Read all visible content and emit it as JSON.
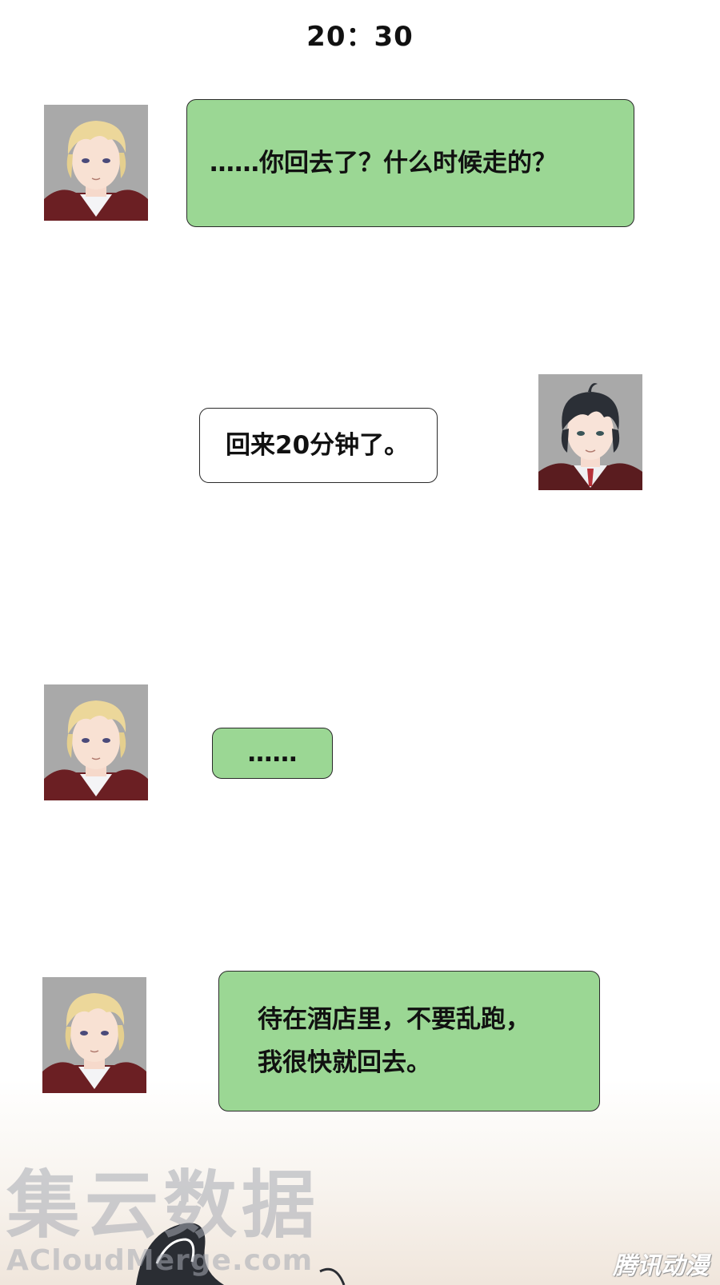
{
  "time": "20：30",
  "messages": [
    {
      "sender": "blond",
      "side": "left",
      "style": "green",
      "text": "……你回去了？什么时候走的？"
    },
    {
      "sender": "dark",
      "side": "right",
      "style": "white",
      "text": "回来20分钟了。"
    },
    {
      "sender": "blond",
      "side": "left",
      "style": "green",
      "text": "……"
    },
    {
      "sender": "blond",
      "side": "left",
      "style": "green",
      "lines": [
        "待在酒店里，不要乱跑，",
        "我很快就回去。"
      ]
    }
  ],
  "watermark": {
    "cn": "集云数据",
    "en": "ACloudMerge.com"
  },
  "brand": "腾讯动漫",
  "colors": {
    "bubble_green": "#9bd794",
    "bubble_white": "#ffffff",
    "avatar_bg": "#a9a9a9"
  }
}
